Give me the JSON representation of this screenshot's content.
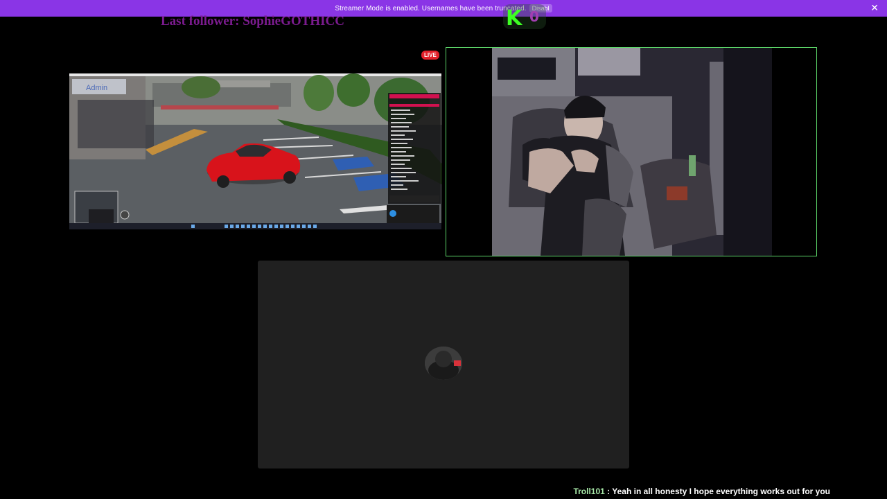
{
  "banner": {
    "text": "Streamer Mode is enabled. Usernames have been truncated.",
    "action_label": "Disabl",
    "close_glyph": "✕",
    "color": "#8a35e6"
  },
  "overlay": {
    "last_follower": "Last follower: SophieGOTHICC",
    "kick_logo_letter": "K",
    "kick_count": "0"
  },
  "stream": {
    "live_label": "LIVE"
  },
  "game": {
    "admin_label": "Admin"
  },
  "chat": {
    "username": "Troll101",
    "separator": " : ",
    "message": "Yeah in all honesty I hope everything works out for you"
  },
  "colors": {
    "cam_border": "#5dd86a",
    "live_badge": "#e3202a",
    "follower_text": "#7b1b8f",
    "kick_green": "#3dff23"
  }
}
